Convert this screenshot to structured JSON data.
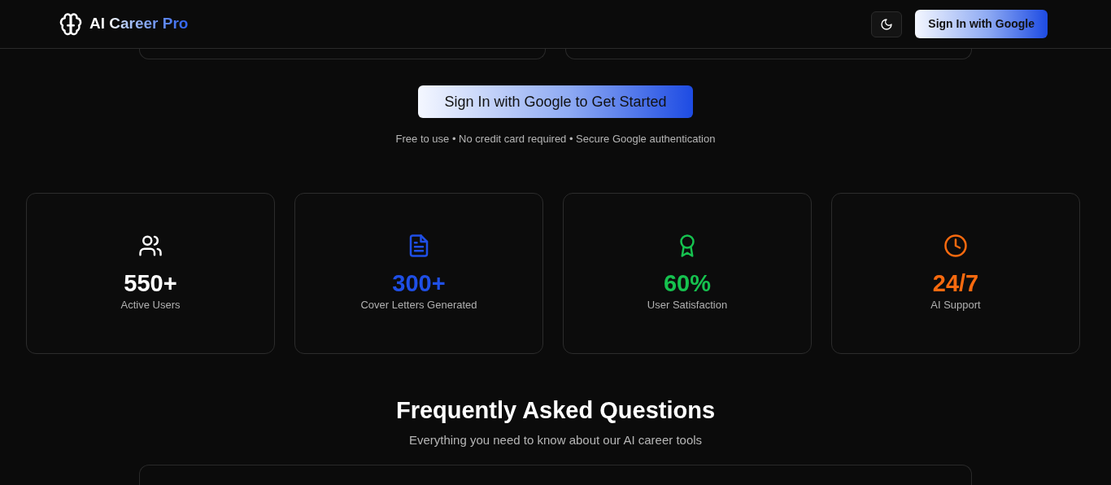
{
  "header": {
    "brand": "AI Career Pro",
    "sign_in": "Sign In with Google"
  },
  "cta": {
    "button": "Sign In with Google to Get Started",
    "note": "Free to use • No credit card required • Secure Google authentication"
  },
  "stats": [
    {
      "kind": "users",
      "value": "550+",
      "label": "Active Users",
      "color": "#ffffff"
    },
    {
      "kind": "document",
      "value": "300+",
      "label": "Cover Letters Generated",
      "color": "#1f4fe6"
    },
    {
      "kind": "award",
      "value": "60%",
      "label": "User Satisfaction",
      "color": "#16c24f"
    },
    {
      "kind": "clock",
      "value": "24/7",
      "label": "AI Support",
      "color": "#f96a0f"
    }
  ],
  "faq": {
    "title": "Frequently Asked Questions",
    "subtitle": "Everything you need to know about our AI career tools"
  }
}
